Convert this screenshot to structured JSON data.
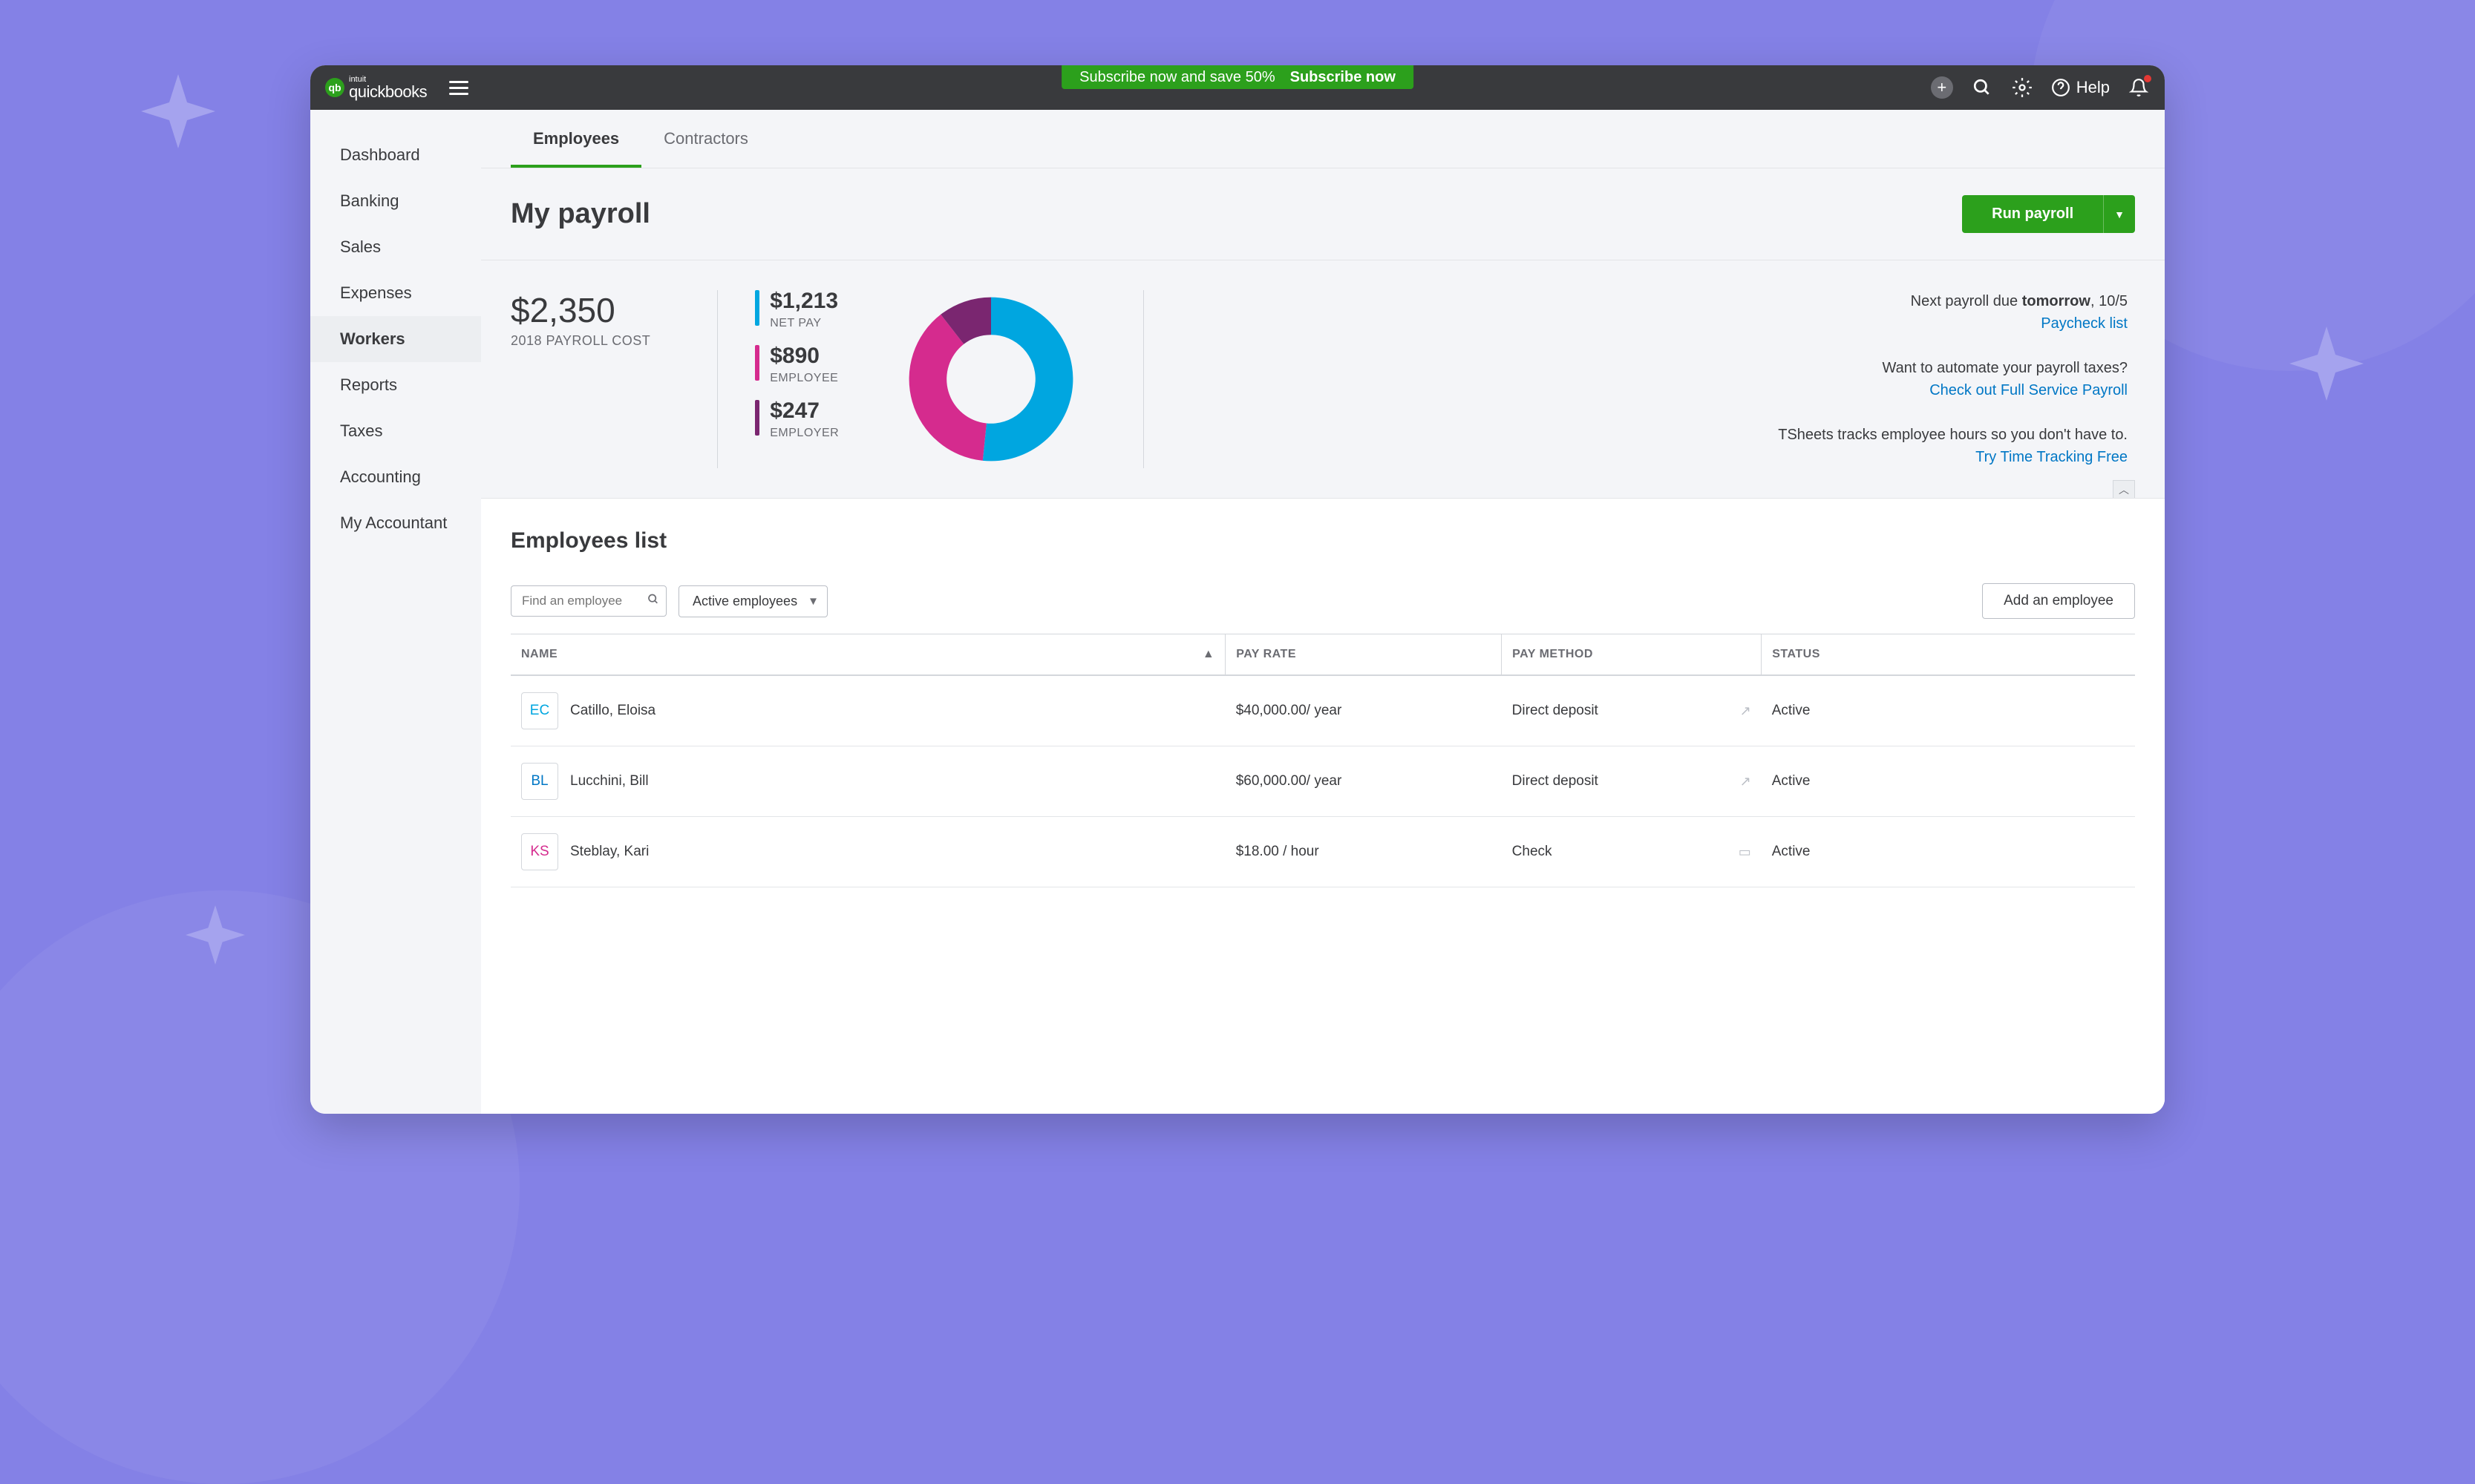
{
  "brand": {
    "intuit": "intuit",
    "name": "quickbooks"
  },
  "promo": {
    "text": "Subscribe now and save 50%",
    "cta": "Subscribe now"
  },
  "topbar": {
    "help": "Help"
  },
  "sidebar": {
    "items": [
      {
        "label": "Dashboard"
      },
      {
        "label": "Banking"
      },
      {
        "label": "Sales"
      },
      {
        "label": "Expenses"
      },
      {
        "label": "Workers"
      },
      {
        "label": "Reports"
      },
      {
        "label": "Taxes"
      },
      {
        "label": "Accounting"
      },
      {
        "label": "My Accountant"
      }
    ],
    "active_index": 4
  },
  "tabs": [
    {
      "label": "Employees"
    },
    {
      "label": "Contractors"
    }
  ],
  "active_tab": 0,
  "page": {
    "title": "My payroll",
    "run_button": "Run payroll"
  },
  "summary": {
    "cost_value": "$2,350",
    "cost_label": "2018 PAYROLL COST",
    "breakdown": [
      {
        "value": "$1,213",
        "label": "NET PAY",
        "color": "#00a6e0"
      },
      {
        "value": "$890",
        "label": "EMPLOYEE",
        "color": "#d52b8e"
      },
      {
        "value": "$247",
        "label": "EMPLOYER",
        "color": "#7a2670"
      }
    ]
  },
  "chart_data": {
    "type": "pie",
    "title": "",
    "series": [
      {
        "name": "NET PAY",
        "value": 1213,
        "color": "#00a6e0"
      },
      {
        "name": "EMPLOYEE",
        "value": 890,
        "color": "#d52b8e"
      },
      {
        "name": "EMPLOYER",
        "value": 247,
        "color": "#7a2670"
      }
    ]
  },
  "info": {
    "next_payroll_prefix": "Next payroll due ",
    "next_payroll_bold": "tomorrow",
    "next_payroll_suffix": ", 10/5",
    "paycheck_link": "Paycheck list",
    "automate_text": "Want to automate your payroll taxes?",
    "automate_link": "Check out Full Service Payroll",
    "tsheets_text": "TSheets tracks employee hours so you don't have to.",
    "tsheets_link": "Try Time Tracking Free"
  },
  "list": {
    "title": "Employees list",
    "search_placeholder": "Find an employee",
    "filter_label": "Active employees",
    "add_button": "Add an employee",
    "columns": {
      "name": "NAME",
      "pay_rate": "PAY RATE",
      "pay_method": "PAY METHOD",
      "status": "STATUS"
    },
    "rows": [
      {
        "initials": "EC",
        "initials_class": "av-ec",
        "name": "Catillo, Eloisa",
        "pay_rate": "$40,000.00/ year",
        "pay_method": "Direct deposit",
        "status": "Active"
      },
      {
        "initials": "BL",
        "initials_class": "av-bl",
        "name": "Lucchini, Bill",
        "pay_rate": "$60,000.00/ year",
        "pay_method": "Direct deposit",
        "status": "Active"
      },
      {
        "initials": "KS",
        "initials_class": "av-ks",
        "name": "Steblay, Kari",
        "pay_rate": "$18.00 / hour",
        "pay_method": "Check",
        "status": "Active"
      }
    ]
  }
}
